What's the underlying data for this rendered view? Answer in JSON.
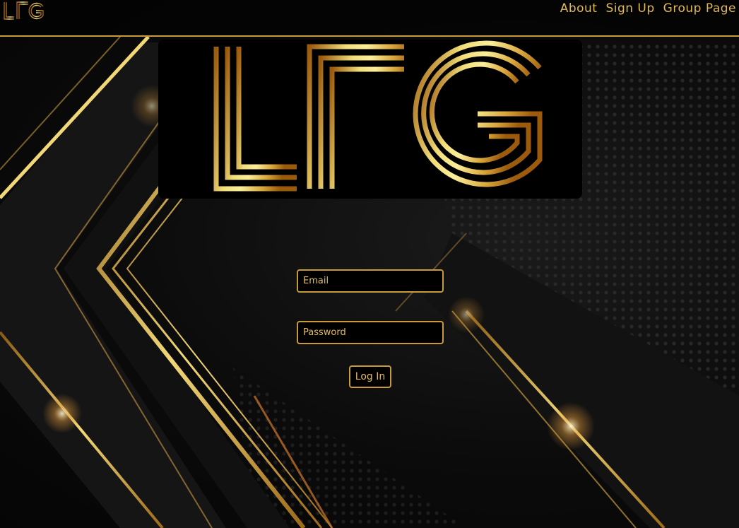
{
  "nav": {
    "logo_text": "LFG",
    "links": [
      {
        "label": "About"
      },
      {
        "label": "Sign Up"
      },
      {
        "label": "Group Page"
      }
    ]
  },
  "hero": {
    "logo_text": "LFG"
  },
  "login": {
    "email_placeholder": "Email",
    "password_placeholder": "Password",
    "button_label": "Log In"
  },
  "colors": {
    "gold": "#c79a3a",
    "gold_light": "#f4e48a",
    "gold_dark": "#a0620f",
    "background": "#0a0a0a"
  }
}
